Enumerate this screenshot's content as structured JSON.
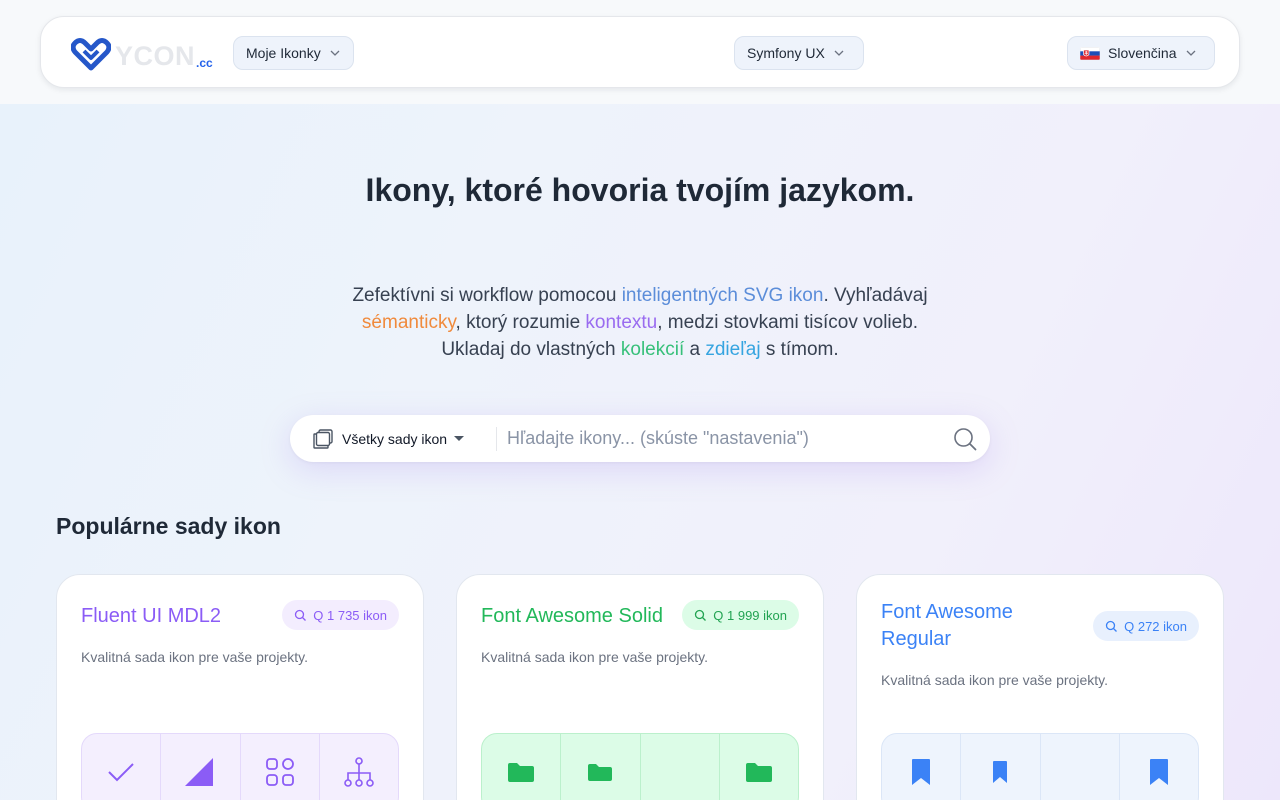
{
  "header": {
    "logo_text": "YCON",
    "logo_suffix": ".cc",
    "my_icons_label": "Moje Ikonky",
    "framework_label": "Symfony UX",
    "language_label": "Slovenčina"
  },
  "hero": {
    "title": "Ikony, ktoré hovoria tvojím jazykom.",
    "subtitle": {
      "p1": "Zefektívni si workflow pomocou ",
      "h1": "inteligentných SVG ikon",
      "p2": ". Vyhľadávaj ",
      "h2": "sémanticky",
      "p3": ", ktorý rozumie ",
      "h3": "kontextu",
      "p4": ", medzi stovkami tisícov volieb. Ukladaj do vlastných ",
      "h4": "kolekcií",
      "p5": " a ",
      "h5": "zdieľaj",
      "p6": " s tímom."
    }
  },
  "search": {
    "set_selector_label": "Všetky sady ikon",
    "placeholder": "Hľadajte ikony... (skúste \"nastavenia\")",
    "value": ""
  },
  "popular": {
    "title": "Populárne sady ikon",
    "cards": [
      {
        "title": "Fluent UI MDL2",
        "count": "Q 1 735 ikon",
        "description": "Kvalitná sada ikon pre vaše projekty.",
        "accent": "#8b5cf6",
        "icons": [
          "checkmark-icon",
          "triangle-corner-icon",
          "apps-grid-icon",
          "org-chart-icon"
        ]
      },
      {
        "title": "Font Awesome Solid",
        "count": "Q 1 999 ikon",
        "description": "Kvalitná sada ikon pre vaše projekty.",
        "accent": "#22b85a",
        "icons": [
          "folder-icon",
          "folder-small-icon",
          "empty",
          "folder-icon"
        ]
      },
      {
        "title": "Font Awesome Regular",
        "count": "Q 272 ikon",
        "description": "Kvalitná sada ikon pre vaše projekty.",
        "accent": "#3b82f6",
        "icons": [
          "bookmark-icon",
          "bookmark-small-icon",
          "empty",
          "bookmark-icon"
        ]
      }
    ]
  }
}
